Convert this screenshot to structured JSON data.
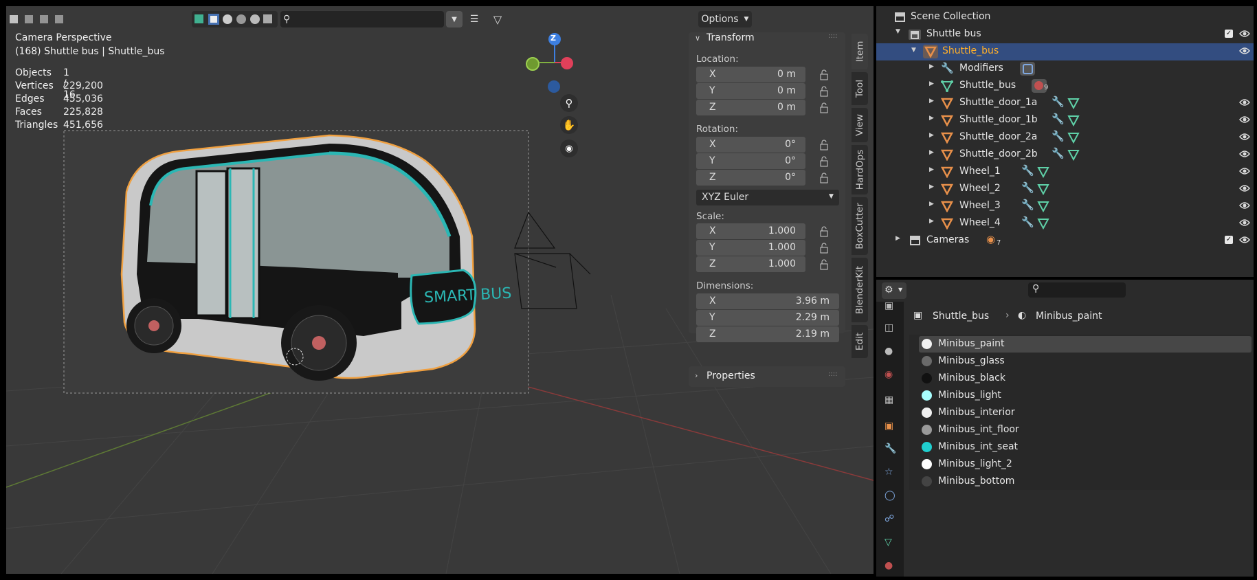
{
  "viewport": {
    "header": {
      "search_placeholder": "",
      "options_label": "Options"
    },
    "overlay": {
      "view_name": "Camera Perspective",
      "object_line": "(168) Shuttle bus | Shuttle_bus",
      "stats": [
        {
          "label": "Objects",
          "value": "1 / 16"
        },
        {
          "label": "Vertices",
          "value": "229,200"
        },
        {
          "label": "Edges",
          "value": "455,036"
        },
        {
          "label": "Faces",
          "value": "225,828"
        },
        {
          "label": "Triangles",
          "value": "451,656"
        }
      ]
    },
    "gizmo": {
      "z": "Z"
    },
    "bus_sign": "SMART BUS"
  },
  "npanel": {
    "transform_title": "Transform",
    "location_label": "Location:",
    "location": [
      {
        "axis": "X",
        "value": "0 m"
      },
      {
        "axis": "Y",
        "value": "0 m"
      },
      {
        "axis": "Z",
        "value": "0 m"
      }
    ],
    "rotation_label": "Rotation:",
    "rotation": [
      {
        "axis": "X",
        "value": "0°"
      },
      {
        "axis": "Y",
        "value": "0°"
      },
      {
        "axis": "Z",
        "value": "0°"
      }
    ],
    "rotation_mode": "XYZ Euler",
    "scale_label": "Scale:",
    "scale": [
      {
        "axis": "X",
        "value": "1.000"
      },
      {
        "axis": "Y",
        "value": "1.000"
      },
      {
        "axis": "Z",
        "value": "1.000"
      }
    ],
    "dimensions_label": "Dimensions:",
    "dimensions": [
      {
        "axis": "X",
        "value": "3.96 m"
      },
      {
        "axis": "Y",
        "value": "2.29 m"
      },
      {
        "axis": "Z",
        "value": "2.19 m"
      }
    ],
    "properties_title": "Properties",
    "tabs": [
      "Item",
      "Tool",
      "View",
      "HardOps",
      "BoxCutter",
      "BlenderKit",
      "Edit"
    ]
  },
  "outliner": {
    "rows": [
      {
        "label": "Scene Collection"
      },
      {
        "label": "Shuttle bus"
      },
      {
        "label": "Shuttle_bus"
      },
      {
        "label": "Modifiers"
      },
      {
        "label": "Shuttle_bus",
        "badge": "9"
      },
      {
        "label": "Shuttle_door_1a"
      },
      {
        "label": "Shuttle_door_1b"
      },
      {
        "label": "Shuttle_door_2a"
      },
      {
        "label": "Shuttle_door_2b"
      },
      {
        "label": "Wheel_1"
      },
      {
        "label": "Wheel_2"
      },
      {
        "label": "Wheel_3"
      },
      {
        "label": "Wheel_4"
      },
      {
        "label": "Cameras",
        "badge": "7"
      }
    ]
  },
  "properties": {
    "breadcrumb_object": "Shuttle_bus",
    "breadcrumb_material": "Minibus_paint",
    "materials": [
      {
        "name": "Minibus_paint",
        "color": "#f2f2f2"
      },
      {
        "name": "Minibus_glass",
        "color": "#6a6a6a"
      },
      {
        "name": "Minibus_black",
        "color": "#111111"
      },
      {
        "name": "Minibus_light",
        "color": "#a8ffff"
      },
      {
        "name": "Minibus_interior",
        "color": "#f0f0f0"
      },
      {
        "name": "Minibus_int_floor",
        "color": "#9a9a9a"
      },
      {
        "name": "Minibus_int_seat",
        "color": "#20d0d0"
      },
      {
        "name": "Minibus_light_2",
        "color": "#ffffff"
      },
      {
        "name": "Minibus_bottom",
        "color": "#444444"
      }
    ]
  },
  "colors": {
    "selection": "#334d80",
    "active_text": "#ffaf29",
    "object_orange": "#e8904a",
    "mesh_green": "#5fd1a8",
    "wrench_blue": "#7fa8e0",
    "teal": "#2bb7b4"
  }
}
